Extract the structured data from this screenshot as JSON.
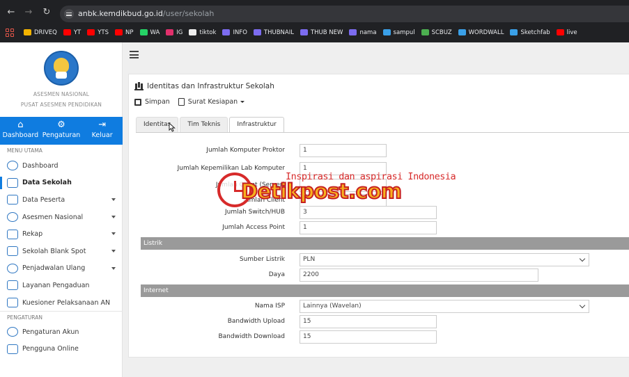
{
  "browser": {
    "url_host": "anbk.kemdikbud.go.id",
    "url_path": "/user/sekolah",
    "bookmarks": [
      {
        "label": "DRIVEQ",
        "color": "#f4b400"
      },
      {
        "label": "YT",
        "color": "#ff0000"
      },
      {
        "label": "YTS",
        "color": "#ff0000"
      },
      {
        "label": "NP",
        "color": "#ff0000"
      },
      {
        "label": "WA",
        "color": "#25d366"
      },
      {
        "label": "IG",
        "color": "#e1306c"
      },
      {
        "label": "tiktok",
        "color": "#eeeeee"
      },
      {
        "label": "INFO",
        "color": "#7c6cf0"
      },
      {
        "label": "THUBNAIL",
        "color": "#7c6cf0"
      },
      {
        "label": "THUB NEW",
        "color": "#7c6cf0"
      },
      {
        "label": "nama",
        "color": "#7c6cf0"
      },
      {
        "label": "sampul",
        "color": "#3aa0e8"
      },
      {
        "label": "SCBUZ",
        "color": "#4caf50"
      },
      {
        "label": "WORDWALL",
        "color": "#3aa0e8"
      },
      {
        "label": "Sketchfab",
        "color": "#3aa0e8"
      },
      {
        "label": "live",
        "color": "#ff0000"
      }
    ]
  },
  "sidebar": {
    "org_line1": "ASESMEN NASIONAL",
    "org_line2": "PUSAT ASESMEN PENDIDIKAN",
    "topnav": [
      {
        "label": "Dashboard",
        "glyph": "⌂"
      },
      {
        "label": "Pengaturan",
        "glyph": "⚙"
      },
      {
        "label": "Keluar",
        "glyph": "⇥"
      }
    ],
    "menu_label": "MENU UTAMA",
    "menu": [
      {
        "label": "Dashboard",
        "caret": false,
        "active": false
      },
      {
        "label": "Data Sekolah",
        "caret": false,
        "active": true
      },
      {
        "label": "Data Peserta",
        "caret": true,
        "active": false
      },
      {
        "label": "Asesmen Nasional",
        "caret": true,
        "active": false
      },
      {
        "label": "Rekap",
        "caret": true,
        "active": false
      },
      {
        "label": "Sekolah Blank Spot",
        "caret": true,
        "active": false
      },
      {
        "label": "Penjadwalan Ulang",
        "caret": true,
        "active": false
      },
      {
        "label": "Layanan Pengaduan",
        "caret": false,
        "active": false
      },
      {
        "label": "Kuesioner Pelaksanaan AN",
        "caret": false,
        "active": false
      }
    ],
    "settings_label": "PENGATURAN",
    "settings": [
      {
        "label": "Pengaturan Akun"
      },
      {
        "label": "Pengguna Online"
      }
    ]
  },
  "panel": {
    "title": "Identitas dan Infrastruktur Sekolah",
    "save_label": "Simpan",
    "letter_label": "Surat Kesiapan",
    "tabs": [
      "Identitas",
      "Tim Teknis",
      "Infrastruktur"
    ],
    "active_tab": "Infrastruktur",
    "fields_top": [
      {
        "label": "Jumlah Komputer Proktor",
        "value": "1"
      },
      {
        "label": "Jumlah Kepemilikan Lab Komputer",
        "value": "1"
      },
      {
        "label": "Jumlah Client (Server)",
        "value": ""
      },
      {
        "label": "Jumlah Client",
        "value": ""
      },
      {
        "label": "Jumlah Switch/HUB",
        "value": "3"
      },
      {
        "label": "Jumlah Access Point",
        "value": "1"
      }
    ],
    "section_listrik": "Listrik",
    "listrik": [
      {
        "label": "Sumber Listrik",
        "value": "PLN"
      },
      {
        "label": "Daya",
        "value": "2200"
      }
    ],
    "section_internet": "Internet",
    "internet": [
      {
        "label": "Nama ISP",
        "value": "Lainnya (Wavelan)"
      },
      {
        "label": "Bandwidth Upload",
        "value": "15"
      },
      {
        "label": "Bandwidth Download",
        "value": "15"
      }
    ]
  },
  "watermark": {
    "tagline": "Inspirasi dan aspirasi Indonesia",
    "brand": "Detikpost.com"
  }
}
